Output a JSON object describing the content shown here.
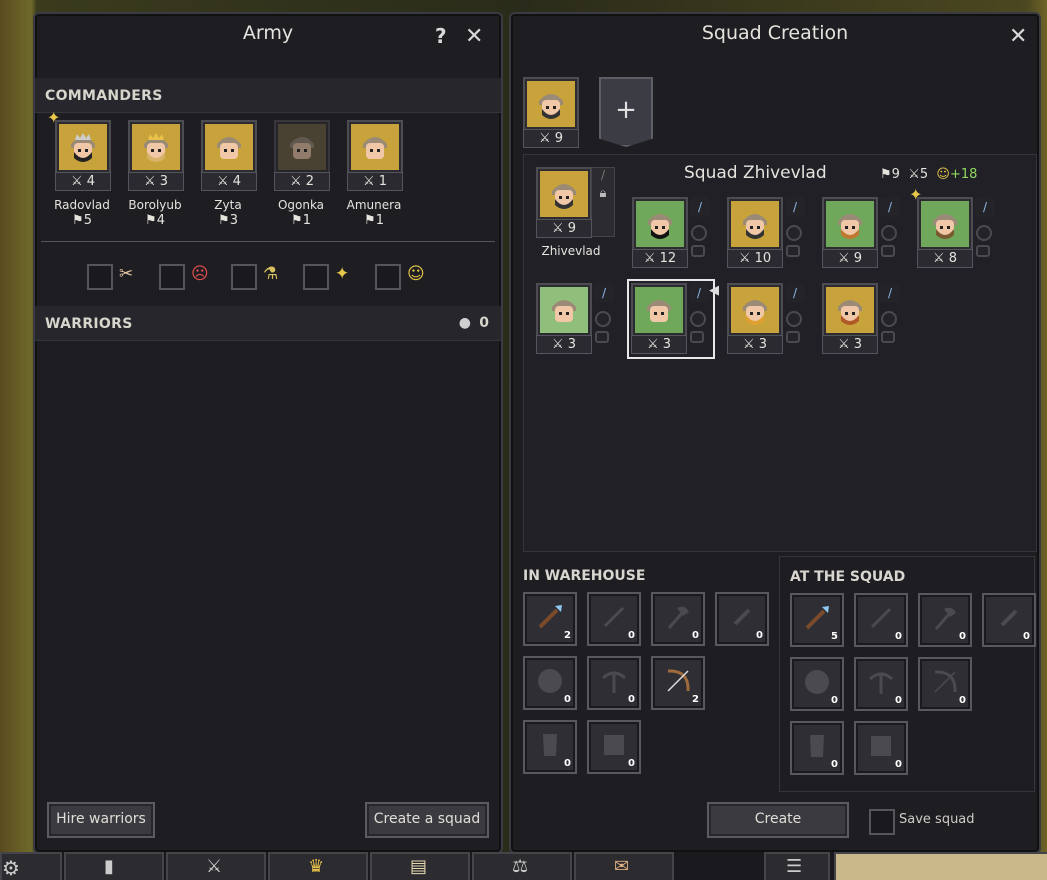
{
  "army": {
    "title": "Army",
    "help": "?",
    "close": "✕",
    "commanders_header": "COMMANDERS",
    "commanders": [
      {
        "name": "Radovlad",
        "strength": "4",
        "flags": "5",
        "bg": "#c8a23a",
        "dim": false,
        "beard": "#222",
        "crown": "#ccc"
      },
      {
        "name": "Borolyub",
        "strength": "3",
        "flags": "4",
        "bg": "#c8a23a",
        "dim": false,
        "beard": "#d9b36a",
        "crown": "#e8c24a"
      },
      {
        "name": "Zyta",
        "strength": "4",
        "flags": "3",
        "bg": "#c8a23a",
        "dim": false,
        "beard": "",
        "crown": ""
      },
      {
        "name": "Ogonka",
        "strength": "2",
        "flags": "1",
        "bg": "#6e6040",
        "dim": true,
        "beard": "",
        "crown": ""
      },
      {
        "name": "Amunera",
        "strength": "1",
        "flags": "1",
        "bg": "#c8a23a",
        "dim": false,
        "beard": "",
        "crown": ""
      }
    ],
    "filters": [
      {
        "icon": "bandage-icon",
        "glyph": "✂",
        "color": "#e8c8a0"
      },
      {
        "icon": "angry-icon",
        "glyph": "☹",
        "color": "#e85050"
      },
      {
        "icon": "potion-icon",
        "glyph": "⚗",
        "color": "#d8c060"
      },
      {
        "icon": "rank-up-icon",
        "glyph": "✦",
        "color": "#e8c84a"
      },
      {
        "icon": "happy-icon",
        "glyph": "☺",
        "color": "#e8c84a"
      }
    ],
    "warriors_header": "WARRIORS",
    "warriors_count": "0",
    "hire_label": "Hire warriors",
    "create_squad_label": "Create a squad"
  },
  "squad": {
    "title": "Squad Creation",
    "close": "✕",
    "top_commander_strength": "9",
    "add": "+",
    "name": "Squad Zhivevlad",
    "stat_flags": "9",
    "stat_strength": "5",
    "stat_mood": "+18",
    "leader": {
      "name": "Zhivevlad",
      "strength": "9"
    },
    "members": [
      {
        "strength": "12",
        "bg": "#6fa85a",
        "beard": "#111",
        "sel": false
      },
      {
        "strength": "10",
        "bg": "#c8a23a",
        "beard": "#333",
        "sel": false
      },
      {
        "strength": "9",
        "bg": "#6fa85a",
        "beard": "#c07830",
        "sel": false
      },
      {
        "strength": "8",
        "bg": "#6fa85a",
        "beard": "#7a5a30",
        "sel": false
      },
      {
        "strength": "3",
        "bg": "#8fbf7a",
        "beard": "",
        "sel": false
      },
      {
        "strength": "3",
        "bg": "#6fa85a",
        "beard": "",
        "sel": true
      },
      {
        "strength": "3",
        "bg": "#c8a23a",
        "beard": "#e0a030",
        "sel": false
      },
      {
        "strength": "3",
        "bg": "#c8a23a",
        "beard": "#b05a28",
        "sel": false
      }
    ],
    "warehouse_header": "IN WAREHOUSE",
    "atsquad_header": "AT THE SQUAD",
    "warehouse": [
      [
        {
          "icon": "spear-icon",
          "n": "2",
          "active": true
        },
        {
          "icon": "sword-icon",
          "n": "0",
          "active": false
        },
        {
          "icon": "axe-icon",
          "n": "0",
          "active": false
        },
        {
          "icon": "dagger-icon",
          "n": "0",
          "active": false
        }
      ],
      [
        {
          "icon": "shield-icon",
          "n": "0",
          "active": false
        },
        {
          "icon": "crossbow-icon",
          "n": "0",
          "active": false
        },
        {
          "icon": "bow-icon",
          "n": "2",
          "active": true
        }
      ],
      [
        {
          "icon": "light-armor-icon",
          "n": "0",
          "active": false
        },
        {
          "icon": "heavy-armor-icon",
          "n": "0",
          "active": false
        }
      ]
    ],
    "atsquad": [
      [
        {
          "icon": "spear-icon",
          "n": "5",
          "active": true
        },
        {
          "icon": "sword-icon",
          "n": "0",
          "active": false
        },
        {
          "icon": "axe-icon",
          "n": "0",
          "active": false
        },
        {
          "icon": "dagger-icon",
          "n": "0",
          "active": false
        }
      ],
      [
        {
          "icon": "shield-icon",
          "n": "0",
          "active": false
        },
        {
          "icon": "crossbow-icon",
          "n": "0",
          "active": false
        },
        {
          "icon": "bow-icon",
          "n": "0",
          "active": false
        }
      ],
      [
        {
          "icon": "light-armor-icon",
          "n": "0",
          "active": false
        },
        {
          "icon": "heavy-armor-icon",
          "n": "0",
          "active": false
        }
      ]
    ],
    "create_label": "Create",
    "save_label": "Save squad"
  }
}
